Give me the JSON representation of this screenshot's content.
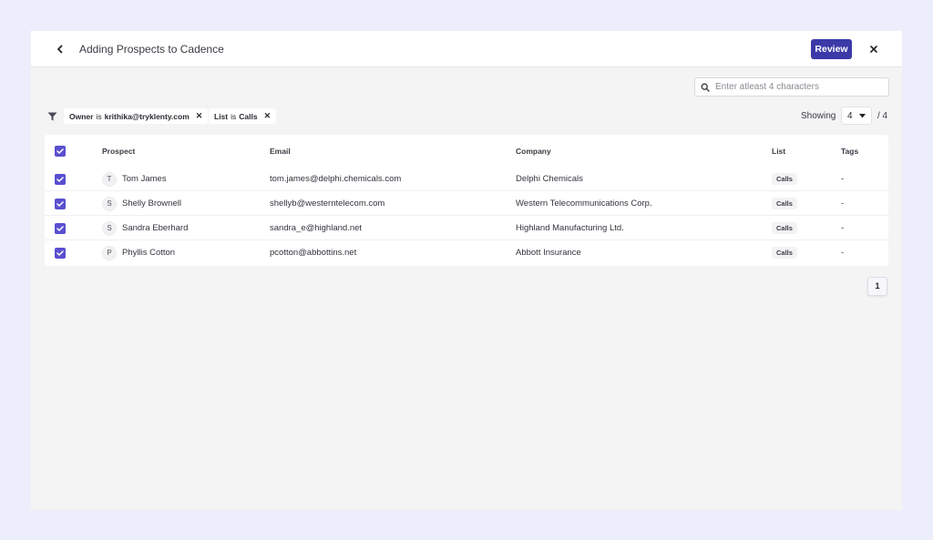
{
  "header": {
    "title": "Adding Prospects to Cadence",
    "review_label": "Review"
  },
  "search": {
    "placeholder": "Enter atleast 4 characters"
  },
  "filters": [
    {
      "key": "Owner",
      "op": "is",
      "value": "krithika@tryklenty.com"
    },
    {
      "key": "List",
      "op": "is",
      "value": "Calls"
    }
  ],
  "paging": {
    "showing_label": "Showing",
    "page_size": "4",
    "total": "/ 4",
    "current_page": "1"
  },
  "table": {
    "columns": [
      "Prospect",
      "Email",
      "Company",
      "List",
      "Tags"
    ],
    "rows": [
      {
        "initial": "T",
        "prospect": "Tom James",
        "email": "tom.james@delphi.chemicals.com",
        "company": "Delphi Chemicals",
        "list": "Calls",
        "tags": "-"
      },
      {
        "initial": "S",
        "prospect": "Shelly Brownell",
        "email": "shellyb@westerntelecom.com",
        "company": "Western Telecommunications Corp.",
        "list": "Calls",
        "tags": "-"
      },
      {
        "initial": "S",
        "prospect": "Sandra Eberhard",
        "email": "sandra_e@highland.net",
        "company": "Highland Manufacturing Ltd.",
        "list": "Calls",
        "tags": "-"
      },
      {
        "initial": "P",
        "prospect": "Phyllis Cotton",
        "email": "pcotton@abbottins.net",
        "company": "Abbott Insurance",
        "list": "Calls",
        "tags": "-"
      }
    ]
  },
  "colors": {
    "accent": "#3b3aa8",
    "checkbox": "#5a4fcf",
    "background": "#eceffb"
  },
  "icons": {
    "back": "chevron-left-icon",
    "close": "close-icon",
    "search": "search-icon",
    "filter": "filter-icon"
  }
}
